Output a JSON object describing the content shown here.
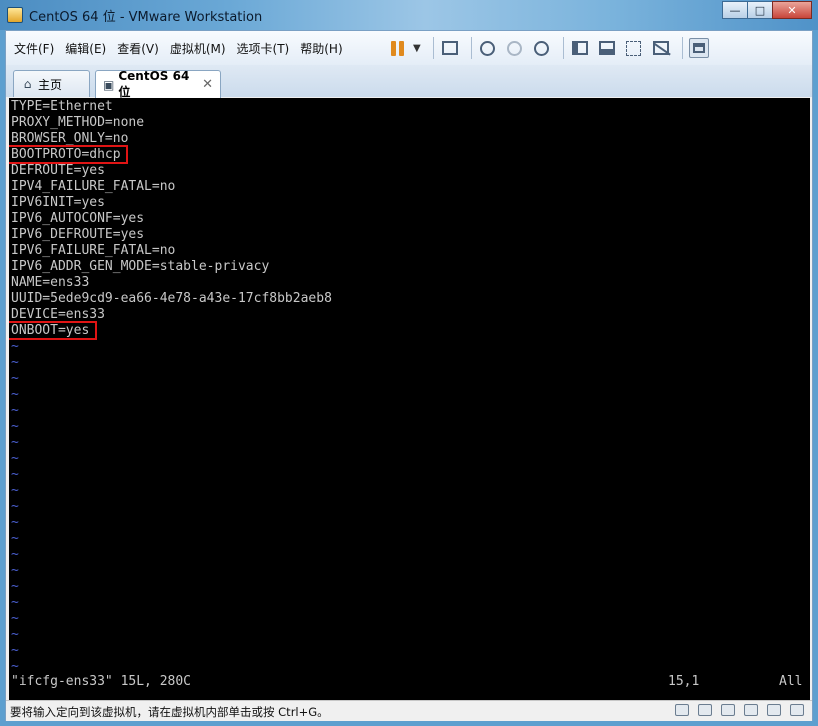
{
  "window": {
    "title": "CentOS 64 位 - VMware Workstation",
    "controls": [
      "minimize",
      "maximize",
      "close"
    ]
  },
  "menu": [
    "文件(F)",
    "编辑(E)",
    "查看(V)",
    "虚拟机(M)",
    "选项卡(T)",
    "帮助(H)"
  ],
  "tabs": [
    {
      "label": "主页",
      "icon": "home-icon"
    },
    {
      "label": "CentOS 64 位",
      "icon": "vm-icon",
      "active": true
    }
  ],
  "terminal": {
    "lines": [
      "TYPE=Ethernet",
      "PROXY_METHOD=none",
      "BROWSER_ONLY=no",
      "BOOTPROTO=dhcp",
      "DEFROUTE=yes",
      "IPV4_FAILURE_FATAL=no",
      "IPV6INIT=yes",
      "IPV6_AUTOCONF=yes",
      "IPV6_DEFROUTE=yes",
      "IPV6_FAILURE_FATAL=no",
      "IPV6_ADDR_GEN_MODE=stable-privacy",
      "NAME=ens33",
      "UUID=5ede9cd9-ea66-4e78-a43e-17cf8bb2aeb8",
      "DEVICE=ens33",
      "ONBOOT=yes"
    ],
    "highlighted_lines": [
      "BOOTPROTO=dhcp",
      "ONBOOT=yes"
    ],
    "empty_marker": "~",
    "status_file": "\"ifcfg-ens33\" 15L, 280C",
    "status_pos": "15,1",
    "status_view": "All"
  },
  "statusbar": {
    "message": "要将输入定向到该虚拟机，请在虚拟机内部单击或按 Ctrl+G。"
  }
}
